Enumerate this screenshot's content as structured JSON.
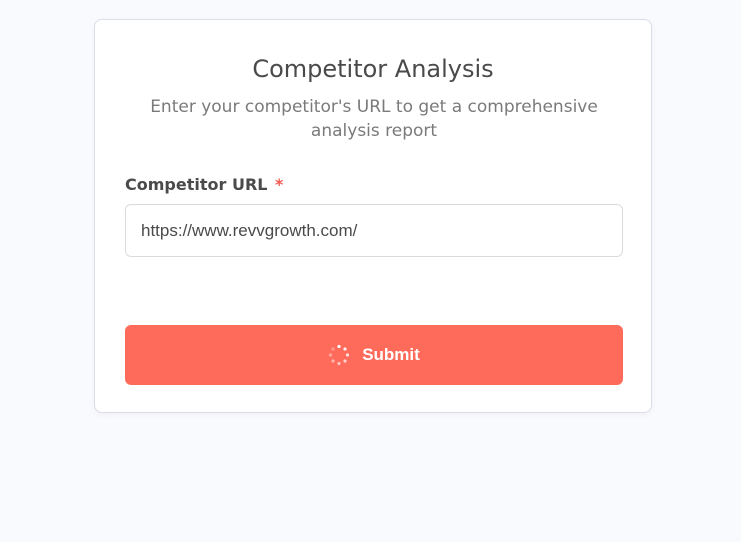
{
  "form": {
    "title": "Competitor Analysis",
    "subtitle": "Enter your competitor's URL to get a comprehensive analysis report",
    "url_label": "Competitor URL",
    "required_mark": "*",
    "url_value": "https://www.revvgrowth.com/",
    "submit_label": "Submit",
    "submit_icon": "loading-spinner-icon"
  },
  "colors": {
    "accent": "#ff6b5b",
    "required": "#ef5a50",
    "background": "#f9fafd"
  }
}
